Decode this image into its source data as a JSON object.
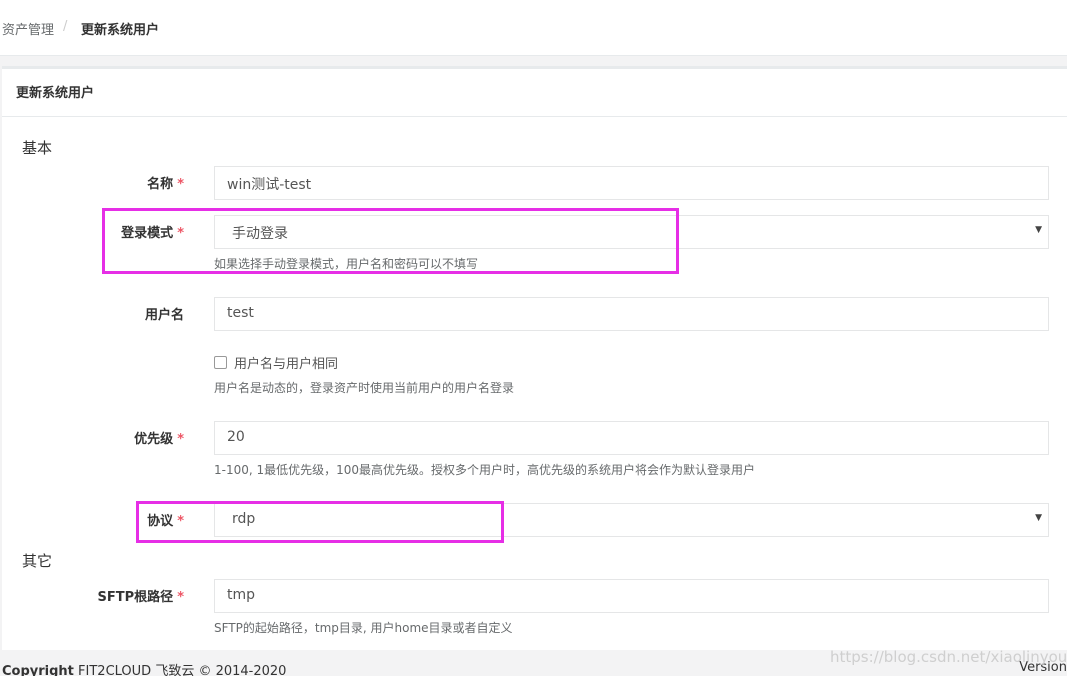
{
  "breadcrumb": {
    "root": "资产管理",
    "separator": "/",
    "current": "更新系统用户"
  },
  "panel": {
    "title": "更新系统用户"
  },
  "sections": {
    "basic": "基本",
    "other": "其它"
  },
  "form": {
    "name": {
      "label": "名称",
      "required": "*",
      "value": "win测试-test"
    },
    "login_mode": {
      "label": "登录模式",
      "required": "*",
      "value": "手动登录",
      "help": "如果选择手动登录模式，用户名和密码可以不填写"
    },
    "username": {
      "label": "用户名",
      "value": "test"
    },
    "same_as_user": {
      "label": "用户名与用户相同",
      "checked": false,
      "help": "用户名是动态的，登录资产时使用当前用户的用户名登录"
    },
    "priority": {
      "label": "优先级",
      "required": "*",
      "value": "20",
      "help": "1-100, 1最低优先级，100最高优先级。授权多个用户时，高优先级的系统用户将会作为默认登录用户"
    },
    "protocol": {
      "label": "协议",
      "required": "*",
      "value": "rdp"
    },
    "sftp_root": {
      "label": "SFTP根路径",
      "required": "*",
      "value": "tmp",
      "help": "SFTP的起始路径，tmp目录, 用户home目录或者自定义"
    }
  },
  "footer": {
    "copyright_label": "Copyright",
    "copyright_text": "FIT2CLOUD 飞致云 © 2014-2020",
    "version": "Version"
  },
  "watermark": "https://blog.csdn.net/xiaolinyouni",
  "icons": {
    "select_arrow": "▼"
  },
  "colors": {
    "highlight": "#e62ee6",
    "required": "#ed5565"
  }
}
